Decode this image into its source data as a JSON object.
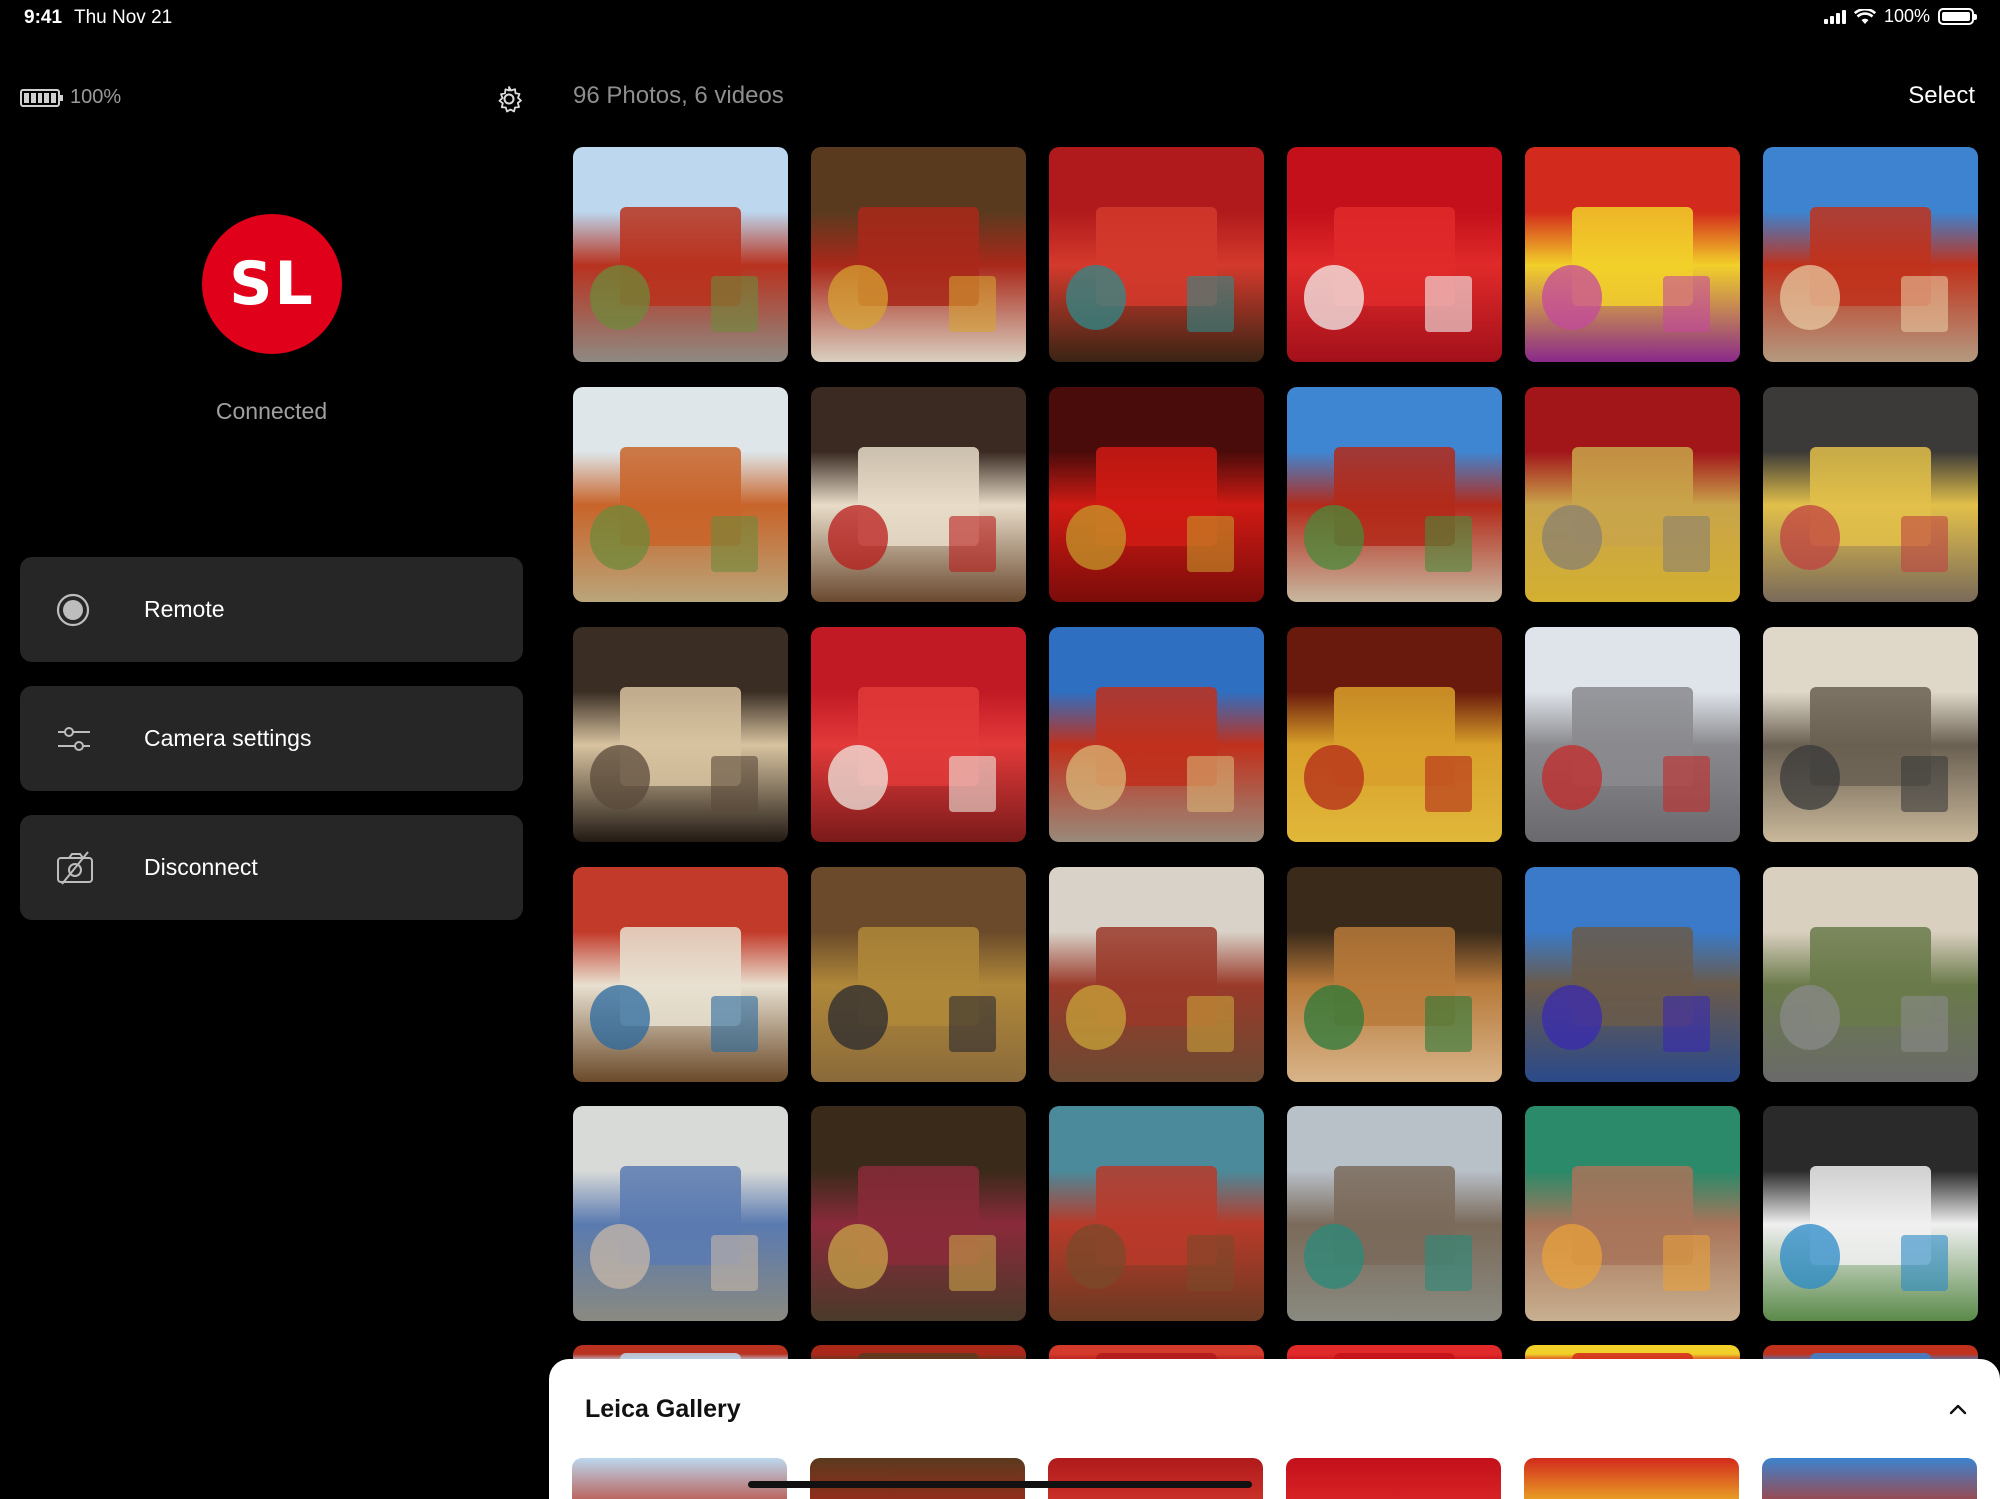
{
  "status_bar": {
    "time": "9:41",
    "date": "Thu Nov 21",
    "battery_pct": "100%"
  },
  "sidebar": {
    "camera_battery": "100%",
    "camera_badge": "SL",
    "connection_status": "Connected",
    "menu": [
      {
        "label": "Remote",
        "icon": "record-icon"
      },
      {
        "label": "Camera settings",
        "icon": "sliders-icon"
      },
      {
        "label": "Disconnect",
        "icon": "disconnect-camera-icon"
      }
    ]
  },
  "main": {
    "count_label": "96 Photos, 6 videos",
    "select_label": "Select"
  },
  "sheet": {
    "title": "Leica Gallery"
  },
  "colors": {
    "brand_red": "#e1001a",
    "panel": "#262626",
    "muted_text": "#8e8e8e"
  },
  "thumbnails": [
    {
      "sky": "#bcd7ee",
      "main": "#b8321f",
      "accent": "#6e8a3a",
      "ground": "#8e8a82"
    },
    {
      "sky": "#5a3a1e",
      "main": "#a9281a",
      "accent": "#d6a132",
      "ground": "#d9d0c0"
    },
    {
      "sky": "#b01a1c",
      "main": "#d33a2c",
      "accent": "#2f8a8a",
      "ground": "#3a2414"
    },
    {
      "sky": "#c3101a",
      "main": "#e02a2a",
      "accent": "#f3f0ee",
      "ground": "#a3101a"
    },
    {
      "sky": "#d22a1c",
      "main": "#f2d02a",
      "accent": "#c44a9e",
      "ground": "#8a2a8a"
    },
    {
      "sky": "#3d83cf",
      "main": "#c0321c",
      "accent": "#e7c8a0",
      "ground": "#b39a80"
    },
    {
      "sky": "#dfe6ea",
      "main": "#c8642a",
      "accent": "#6e8a3a",
      "ground": "#b9a57a"
    },
    {
      "sky": "#3a2a22",
      "main": "#e8dcc8",
      "accent": "#b91c1c",
      "ground": "#6a4a30"
    },
    {
      "sky": "#4a0c0a",
      "main": "#d01a14",
      "accent": "#c49a2a",
      "ground": "#7a0c0a"
    },
    {
      "sky": "#3f86d2",
      "main": "#b32a1a",
      "accent": "#4a8a3a",
      "ground": "#c8b8a0"
    },
    {
      "sky": "#a2161a",
      "main": "#c9a44a",
      "accent": "#8a8070",
      "ground": "#d3b030"
    },
    {
      "sky": "#3c3a38",
      "main": "#e2c04a",
      "accent": "#c04242",
      "ground": "#7a6a5a"
    },
    {
      "sky": "#3a2e24",
      "main": "#d8c3a0",
      "accent": "#5a4a3a",
      "ground": "#221a14"
    },
    {
      "sky": "#c21a24",
      "main": "#e23a3a",
      "accent": "#f0e8e0",
      "ground": "#7a1a1a"
    },
    {
      "sky": "#2e6fc2",
      "main": "#c0301c",
      "accent": "#d9b878",
      "ground": "#9a8a7a"
    },
    {
      "sky": "#6a1a0c",
      "main": "#d8a02a",
      "accent": "#b42a1a",
      "ground": "#e0b83a"
    },
    {
      "sky": "#dfe4ea",
      "main": "#8a8a8e",
      "accent": "#c42a2a",
      "ground": "#6a6a6e"
    },
    {
      "sky": "#dfd8c8",
      "main": "#6a6052",
      "accent": "#3a3a3a",
      "ground": "#c9b89a"
    },
    {
      "sky": "#c23a2a",
      "main": "#e8e0d0",
      "accent": "#2a6aa0",
      "ground": "#6a4a2a"
    },
    {
      "sky": "#6a4a2a",
      "main": "#b0883a",
      "accent": "#2a2a30",
      "ground": "#8a6a3a"
    },
    {
      "sky": "#d8d2c8",
      "main": "#9a3a2a",
      "accent": "#c8a43a",
      "ground": "#6a4a32"
    },
    {
      "sky": "#3a2a1a",
      "main": "#b87a3a",
      "accent": "#2a7a3a",
      "ground": "#d8b48a"
    },
    {
      "sky": "#3a7ac8",
      "main": "#6a5a4a",
      "accent": "#3a2ab2",
      "ground": "#2a4a8a"
    },
    {
      "sky": "#dad0c0",
      "main": "#6a7a4a",
      "accent": "#8a8a8a",
      "ground": "#6a6a6a"
    },
    {
      "sky": "#d8dad8",
      "main": "#5a7ab0",
      "accent": "#c8b8a8",
      "ground": "#8a8a80"
    },
    {
      "sky": "#3a2a1a",
      "main": "#8a2a3a",
      "accent": "#c8a44a",
      "ground": "#4a3a2a"
    },
    {
      "sky": "#4a8a9a",
      "main": "#b83a2a",
      "accent": "#7a4a2a",
      "ground": "#6a3a22"
    },
    {
      "sky": "#b8c0c8",
      "main": "#7a6a5a",
      "accent": "#2a8a7a",
      "ground": "#8a8a80"
    },
    {
      "sky": "#2a8a6a",
      "main": "#a8745a",
      "accent": "#e8a03a",
      "ground": "#c8b090"
    },
    {
      "sky": "#2a2a2a",
      "main": "#f0f0f0",
      "accent": "#2a8ac8",
      "ground": "#5a8a4a"
    }
  ],
  "strip": [
    {
      "sky": "#bcd7ee",
      "main": "#b8321f"
    },
    {
      "sky": "#5a3a1e",
      "main": "#a9281a"
    },
    {
      "sky": "#b01a1c",
      "main": "#d33a2c"
    },
    {
      "sky": "#c3101a",
      "main": "#e02a2a"
    },
    {
      "sky": "#d22a1c",
      "main": "#f2d02a"
    },
    {
      "sky": "#3d83cf",
      "main": "#c0321c"
    }
  ]
}
